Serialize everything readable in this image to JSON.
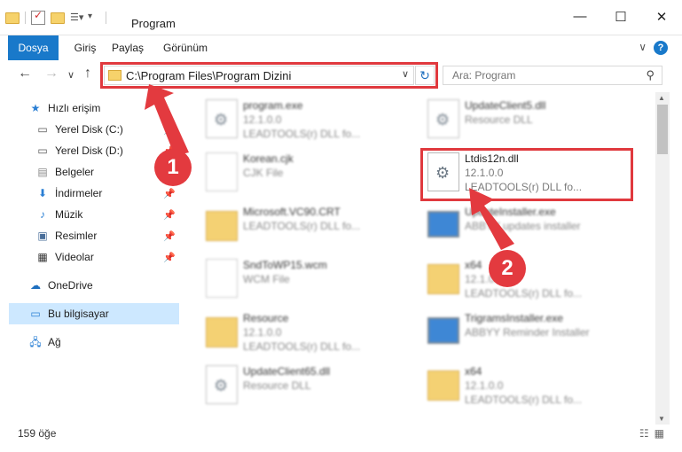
{
  "window": {
    "title": "Program",
    "controls": [
      "—",
      "☐",
      "✕"
    ]
  },
  "ribbon": {
    "tabs": [
      "Dosya",
      "Giriş",
      "Paylaş",
      "Görünüm"
    ]
  },
  "address": {
    "path": "C:\\Program Files\\Program Dizini"
  },
  "search": {
    "placeholder": "Ara: Program"
  },
  "sidebar": {
    "items": [
      {
        "label": "Hızlı erişim",
        "icon": "star-icon"
      },
      {
        "label": "Yerel Disk (C:)",
        "icon": "drive-icon"
      },
      {
        "label": "Yerel Disk (D:)",
        "icon": "drive-icon"
      },
      {
        "label": "Belgeler",
        "icon": "documents-icon"
      },
      {
        "label": "İndirmeler",
        "icon": "download-icon"
      },
      {
        "label": "Müzik",
        "icon": "music-icon"
      },
      {
        "label": "Resimler",
        "icon": "pictures-icon"
      },
      {
        "label": "Videolar",
        "icon": "videos-icon"
      },
      {
        "label": "OneDrive",
        "icon": "cloud-icon"
      },
      {
        "label": "Bu bilgisayar",
        "icon": "computer-icon"
      },
      {
        "label": "Ağ",
        "icon": "network-icon"
      }
    ]
  },
  "files": [
    {
      "name": "program.exe",
      "line2": "12.1.0.0",
      "line3": "LEADTOOLS(r) DLL fo..."
    },
    {
      "name": "UpdateClient5.dll",
      "line2": "Resource DLL",
      "line3": ""
    },
    {
      "name": "Korean.cjk",
      "line2": "CJK File",
      "line3": ""
    },
    {
      "name": "Ltdis12n.dll",
      "line2": "12.1.0.0",
      "line3": "LEADTOOLS(r) DLL fo..."
    },
    {
      "name": "Microsoft.VC90.CRT",
      "line2": "LEADTOOLS(r) DLL fo...",
      "line3": ""
    },
    {
      "name": "UpdateInstaller.exe",
      "line2": "ABBYY updates installer",
      "line3": ""
    },
    {
      "name": "SndToWP15.wcm",
      "line2": "WCM File",
      "line3": ""
    },
    {
      "name": "x64",
      "line2": "12.1.0.0",
      "line3": "LEADTOOLS(r) DLL fo..."
    },
    {
      "name": "Resource",
      "line2": "12.1.0.0",
      "line3": "LEADTOOLS(r) DLL fo..."
    },
    {
      "name": "TrigramsInstaller.exe",
      "line2": "ABBYY Reminder Installer",
      "line3": ""
    },
    {
      "name": "UpdateClient65.dll",
      "line2": "Resource DLL",
      "line3": ""
    },
    {
      "name": "x64",
      "line2": "12.1.0.0",
      "line3": "LEADTOOLS(r) DLL fo..."
    }
  ],
  "status": {
    "count": "159 öğe"
  },
  "callouts": [
    "1",
    "2"
  ],
  "colors": {
    "accent": "#1979ca",
    "highlight": "#e0393e",
    "selected": "#cde8ff"
  }
}
